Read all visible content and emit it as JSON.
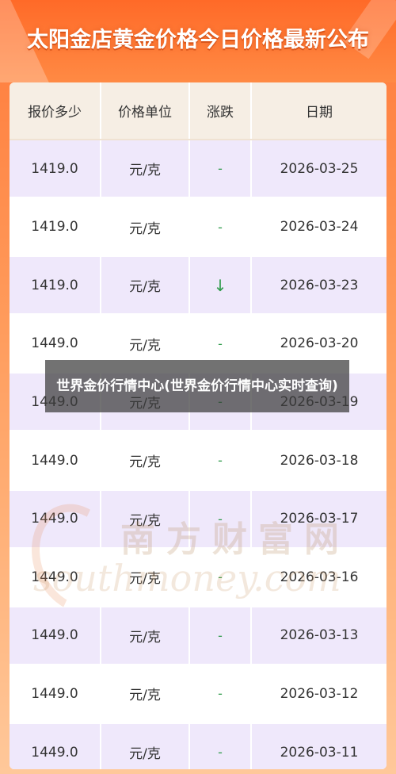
{
  "header": {
    "title": "太阳金店黄金价格今日价格最新公布"
  },
  "table": {
    "columns": [
      "报价多少",
      "价格单位",
      "涨跌",
      "日期"
    ],
    "rows": [
      {
        "price": "1419.0",
        "unit": "元/克",
        "change": "-",
        "date": "2026-03-25"
      },
      {
        "price": "1419.0",
        "unit": "元/克",
        "change": "-",
        "date": "2026-03-24"
      },
      {
        "price": "1419.0",
        "unit": "元/克",
        "change": "↓",
        "date": "2026-03-23"
      },
      {
        "price": "1449.0",
        "unit": "元/克",
        "change": "-",
        "date": "2026-03-20"
      },
      {
        "price": "1449.0",
        "unit": "元/克",
        "change": "-",
        "date": "2026-03-19"
      },
      {
        "price": "1449.0",
        "unit": "元/克",
        "change": "-",
        "date": "2026-03-18"
      },
      {
        "price": "1449.0",
        "unit": "元/克",
        "change": "-",
        "date": "2026-03-17"
      },
      {
        "price": "1449.0",
        "unit": "元/克",
        "change": "-",
        "date": "2026-03-16"
      },
      {
        "price": "1449.0",
        "unit": "元/克",
        "change": "-",
        "date": "2026-03-13"
      },
      {
        "price": "1449.0",
        "unit": "元/克",
        "change": "-",
        "date": "2026-03-12"
      },
      {
        "price": "1449.0",
        "unit": "元/克",
        "change": "-",
        "date": "2026-03-11"
      }
    ]
  },
  "watermark": {
    "cn": "南方财富网",
    "en": "southmoney.com"
  },
  "overlay": {
    "caption": "世界金价行情中心(世界金价行情中心实时查询)"
  },
  "colors": {
    "header_orange": "#ff6a28",
    "row_lavender": "#efe8fb",
    "header_row": "#f6eee4",
    "trend_green": "#2e9a4a"
  }
}
